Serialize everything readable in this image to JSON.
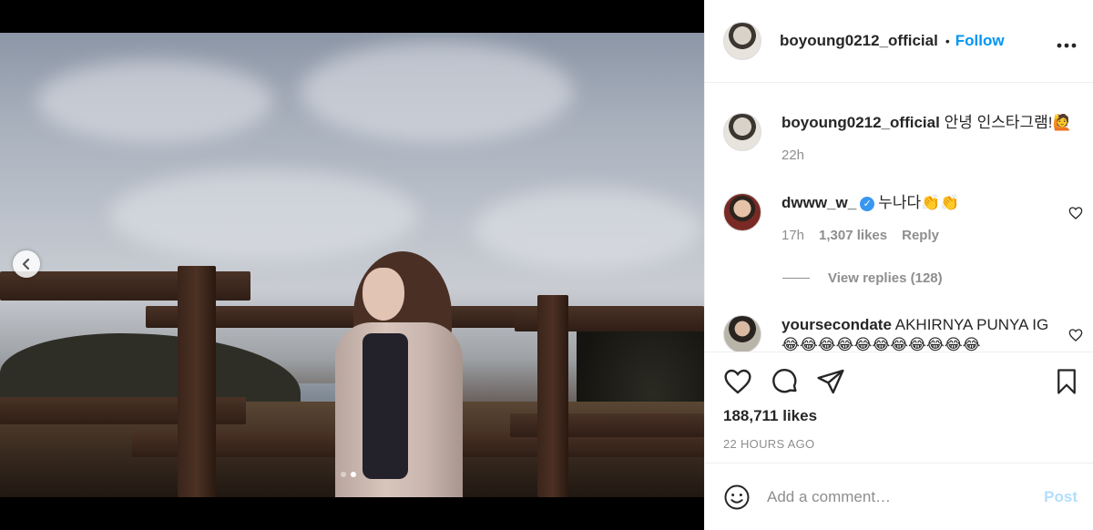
{
  "post": {
    "username": "boyoung0212_official",
    "separator": "•",
    "follow_label": "Follow",
    "more_label": "•••",
    "media": {
      "current_slide": 2,
      "total_slides": 2
    }
  },
  "comments": [
    {
      "username": "boyoung0212_official",
      "text": "안녕 인스타그램!🙋",
      "time": "22h"
    },
    {
      "username": "dwww_w_",
      "verified": true,
      "text": "누나다👏👏",
      "time": "17h",
      "likes": "1,307 likes",
      "reply_label": "Reply"
    },
    {
      "username": "yoursecondate",
      "text": "AKHIRNYA PUNYA IG😂😂😂😂😂😂😂😂😂😂😂"
    }
  ],
  "view_replies": "View replies (128)",
  "likes": "188,711 likes",
  "time_ago": "22 HOURS AGO",
  "composer": {
    "placeholder": "Add a comment…",
    "post_label": "Post"
  },
  "colors": {
    "accent": "#0095f6",
    "post_disabled": "#b2dffc",
    "muted": "#8e8e8e",
    "text": "#262626",
    "verified": "#3897f0"
  }
}
